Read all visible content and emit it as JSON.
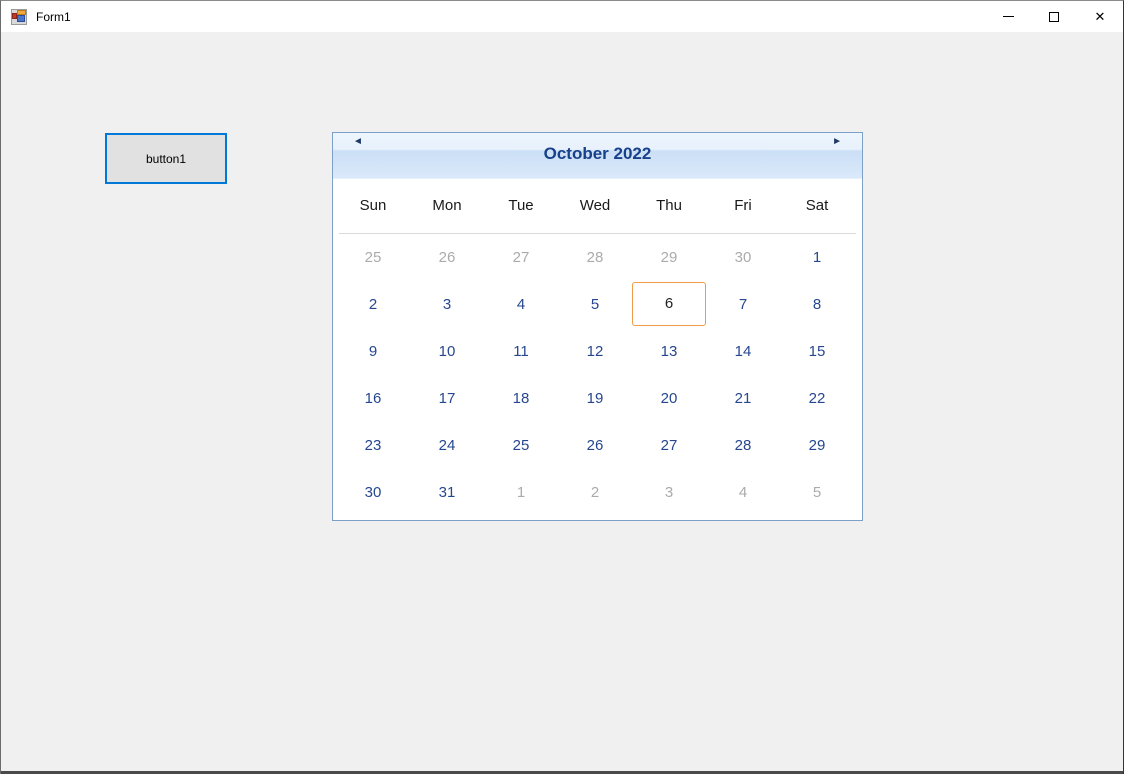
{
  "window": {
    "title": "Form1",
    "controls": [
      {
        "name": "minimize"
      },
      {
        "name": "maximize"
      },
      {
        "name": "close"
      }
    ],
    "close_glyph": "✕"
  },
  "button": {
    "label": "button1"
  },
  "calendar": {
    "title": "October 2022",
    "nav": {
      "prev_icon": "◄",
      "next_icon": "►"
    },
    "day_headers": [
      "Sun",
      "Mon",
      "Tue",
      "Wed",
      "Thu",
      "Fri",
      "Sat"
    ],
    "today_day": "6",
    "weeks": [
      [
        {
          "day": "25",
          "state": "other"
        },
        {
          "day": "26",
          "state": "other"
        },
        {
          "day": "27",
          "state": "other"
        },
        {
          "day": "28",
          "state": "other"
        },
        {
          "day": "29",
          "state": "other"
        },
        {
          "day": "30",
          "state": "other"
        },
        {
          "day": "1",
          "state": "current"
        }
      ],
      [
        {
          "day": "2",
          "state": "current"
        },
        {
          "day": "3",
          "state": "current"
        },
        {
          "day": "4",
          "state": "current"
        },
        {
          "day": "5",
          "state": "current"
        },
        {
          "day": "6",
          "state": "today"
        },
        {
          "day": "7",
          "state": "current"
        },
        {
          "day": "8",
          "state": "current"
        }
      ],
      [
        {
          "day": "9",
          "state": "current"
        },
        {
          "day": "10",
          "state": "current"
        },
        {
          "day": "11",
          "state": "current"
        },
        {
          "day": "12",
          "state": "current"
        },
        {
          "day": "13",
          "state": "current"
        },
        {
          "day": "14",
          "state": "current"
        },
        {
          "day": "15",
          "state": "current"
        }
      ],
      [
        {
          "day": "16",
          "state": "current"
        },
        {
          "day": "17",
          "state": "current"
        },
        {
          "day": "18",
          "state": "current"
        },
        {
          "day": "19",
          "state": "current"
        },
        {
          "day": "20",
          "state": "current"
        },
        {
          "day": "21",
          "state": "current"
        },
        {
          "day": "22",
          "state": "current"
        }
      ],
      [
        {
          "day": "23",
          "state": "current"
        },
        {
          "day": "24",
          "state": "current"
        },
        {
          "day": "25",
          "state": "current"
        },
        {
          "day": "26",
          "state": "current"
        },
        {
          "day": "27",
          "state": "current"
        },
        {
          "day": "28",
          "state": "current"
        },
        {
          "day": "29",
          "state": "current"
        }
      ],
      [
        {
          "day": "30",
          "state": "current"
        },
        {
          "day": "31",
          "state": "current"
        },
        {
          "day": "1",
          "state": "other"
        },
        {
          "day": "2",
          "state": "other"
        },
        {
          "day": "3",
          "state": "other"
        },
        {
          "day": "4",
          "state": "other"
        },
        {
          "day": "5",
          "state": "other"
        }
      ]
    ]
  },
  "colors": {
    "form_background": "#F0F0F0",
    "titlebar_background": "#FFFFFF",
    "button_focus_border": "#0078D7",
    "button_background": "#E1E1E1",
    "calendar_border": "#7CA0C7",
    "calendar_header_blue": "#CBDFF6",
    "calendar_title_text": "#17418A",
    "date_text": "#26478F",
    "other_month_text": "#ABABAB",
    "today_border": "#F09B47"
  }
}
